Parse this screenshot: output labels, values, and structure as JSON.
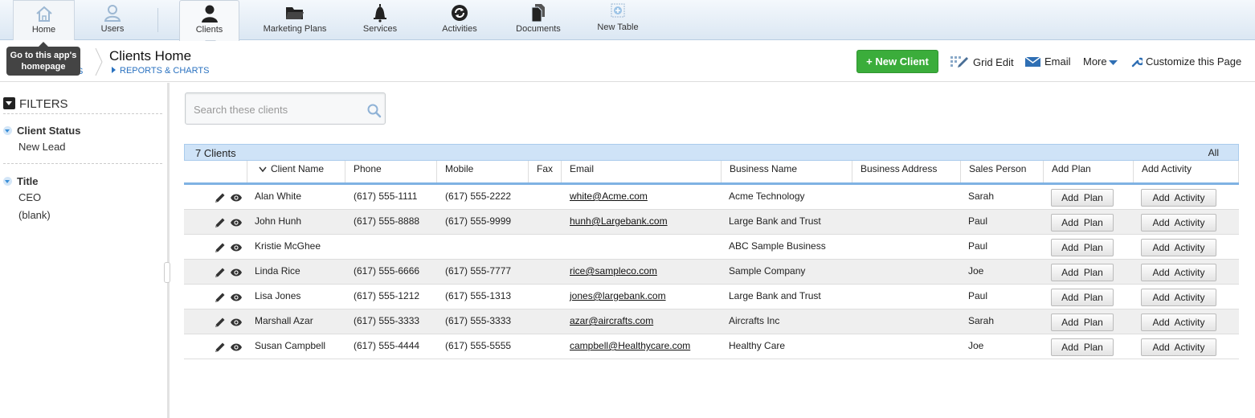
{
  "nav": {
    "tabs": [
      {
        "label": "Home",
        "icon": "house-icon"
      },
      {
        "label": "Users",
        "icon": "user-outline-icon"
      },
      {
        "label": "Clients",
        "icon": "person-icon"
      },
      {
        "label": "Marketing Plans",
        "icon": "folder-icon"
      },
      {
        "label": "Services",
        "icon": "bell-icon"
      },
      {
        "label": "Activities",
        "icon": "refresh-icon"
      },
      {
        "label": "Documents",
        "icon": "documents-icon"
      },
      {
        "label": "New Table",
        "icon": "add-table-icon"
      }
    ],
    "active": "Clients"
  },
  "tooltip": {
    "text": "Go to this app's homepage"
  },
  "subheader": {
    "partial_link": "S",
    "title": "Clients Home",
    "reports_link": "REPORTS & CHARTS",
    "new_button": "+ New Client",
    "actions": {
      "grid_edit": "Grid Edit",
      "email": "Email",
      "more": "More",
      "customize": "Customize this Page"
    }
  },
  "sidebar": {
    "header": "FILTERS",
    "groups": [
      {
        "title": "Client Status",
        "values": [
          "New Lead"
        ]
      },
      {
        "title": "Title",
        "values": [
          "CEO",
          "(blank)"
        ]
      }
    ]
  },
  "search": {
    "placeholder": "Search these clients",
    "value": ""
  },
  "table": {
    "count_label": "7 Clients",
    "all_label": "All",
    "columns": [
      "Client Name",
      "Phone",
      "Mobile",
      "Fax",
      "Email",
      "Business Name",
      "Business Address",
      "Sales Person",
      "Add Plan",
      "Add Activity"
    ],
    "add_plan_label": "Add Plan",
    "add_activity_label": "Add Activity",
    "rows": [
      {
        "name": "Alan White",
        "phone": "(617) 555-1111",
        "mobile": "(617) 555-2222",
        "fax": "",
        "email": "white@Acme.com",
        "business": "Acme Technology",
        "address": "",
        "sales": "Sarah"
      },
      {
        "name": "John Hunh",
        "phone": "(617) 555-8888",
        "mobile": "(617) 555-9999",
        "fax": "",
        "email": "hunh@Largebank.com",
        "business": "Large Bank and Trust",
        "address": "",
        "sales": "Paul"
      },
      {
        "name": "Kristie McGhee",
        "phone": "",
        "mobile": "",
        "fax": "",
        "email": "",
        "business": "ABC Sample Business",
        "address": "",
        "sales": "Paul"
      },
      {
        "name": "Linda Rice",
        "phone": "(617) 555-6666",
        "mobile": "(617) 555-7777",
        "fax": "",
        "email": "rice@sampleco.com",
        "business": "Sample Company",
        "address": "",
        "sales": "Joe"
      },
      {
        "name": "Lisa Jones",
        "phone": "(617) 555-1212",
        "mobile": "(617) 555-1313",
        "fax": "",
        "email": "jones@largebank.com",
        "business": "Large Bank and Trust",
        "address": "",
        "sales": "Paul"
      },
      {
        "name": "Marshall Azar",
        "phone": "(617) 555-3333",
        "mobile": "(617) 555-3333",
        "fax": "",
        "email": "azar@aircrafts.com",
        "business": "Aircrafts Inc",
        "address": "",
        "sales": "Sarah"
      },
      {
        "name": "Susan Campbell",
        "phone": "(617) 555-4444",
        "mobile": "(617) 555-5555",
        "fax": "",
        "email": "campbell@Healthycare.com",
        "business": "Healthy Care",
        "address": "",
        "sales": "Joe"
      }
    ]
  },
  "colors": {
    "accent": "#3bad3b",
    "link": "#2a72c0",
    "header_band": "#cfe3f7"
  }
}
